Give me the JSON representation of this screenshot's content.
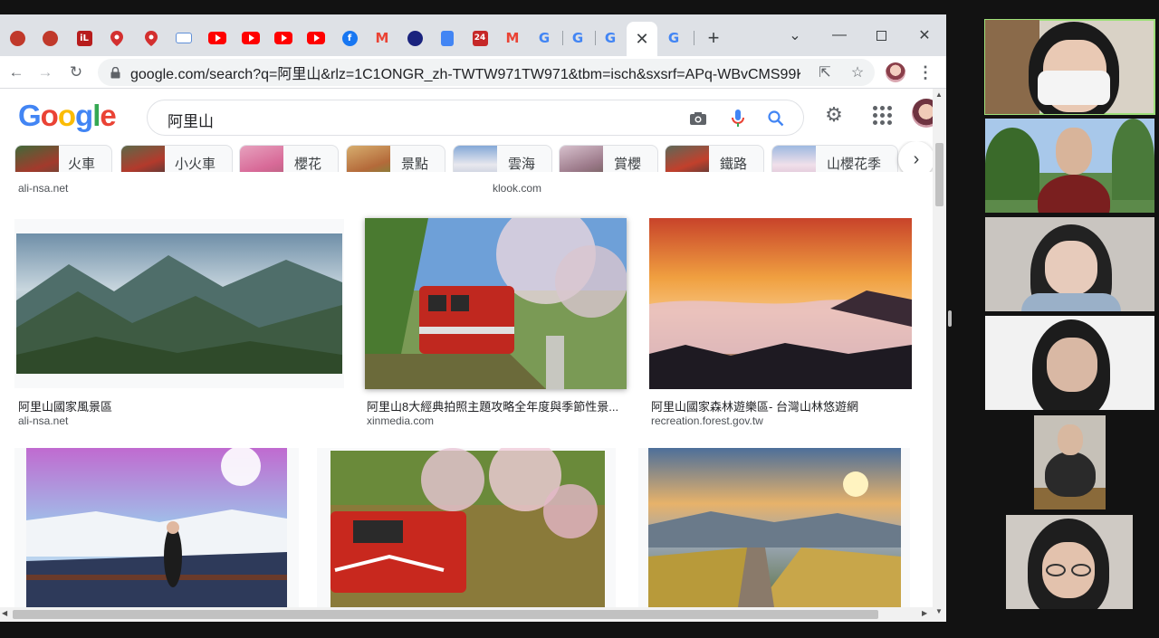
{
  "browser": {
    "tabs": [
      {
        "icon": "tab-favicon-red-swirl"
      },
      {
        "icon": "tab-favicon-red-swirl"
      },
      {
        "icon": "tab-favicon-il",
        "text": "iL"
      },
      {
        "icon": "map-pin-icon"
      },
      {
        "icon": "map-pin-icon"
      },
      {
        "icon": "keyboard-icon"
      },
      {
        "icon": "youtube-icon"
      },
      {
        "icon": "youtube-icon"
      },
      {
        "icon": "youtube-icon"
      },
      {
        "icon": "youtube-icon"
      },
      {
        "icon": "facebook-icon",
        "text": "f"
      },
      {
        "icon": "gmail-icon",
        "text": "M"
      },
      {
        "icon": "globe-icon"
      },
      {
        "icon": "docs-icon"
      },
      {
        "icon": "tab-favicon-24",
        "text": "24"
      },
      {
        "icon": "gmail-icon",
        "text": "M"
      },
      {
        "icon": "google-icon",
        "text": "G"
      },
      {
        "icon": "google-icon",
        "text": "G"
      },
      {
        "icon": "google-icon",
        "text": "G"
      },
      {
        "icon": "google-icon",
        "text": "G",
        "active": true
      },
      {
        "icon": "google-icon",
        "text": "G"
      }
    ],
    "new_tab_label": "+",
    "url": "google.com/search?q=阿里山&rlz=1C1ONGR_zh-TWTW971TW971&tbm=isch&sxsrf=APq-WBvCMS99K2..."
  },
  "google": {
    "logo": [
      "G",
      "o",
      "o",
      "g",
      "l",
      "e"
    ],
    "logo_colors": [
      "#4285f4",
      "#ea4335",
      "#fbbc05",
      "#4285f4",
      "#34a853",
      "#ea4335"
    ],
    "query": "阿里山",
    "chips": [
      {
        "label": "火車"
      },
      {
        "label": "小火車"
      },
      {
        "label": "櫻花"
      },
      {
        "label": "景點"
      },
      {
        "label": "雲海"
      },
      {
        "label": "賞櫻"
      },
      {
        "label": "鐵路"
      },
      {
        "label": "山櫻花季"
      }
    ],
    "top_sources": [
      "ali-nsa.net",
      "klook.com"
    ],
    "results": [
      {
        "title": "阿里山國家風景區",
        "source": "ali-nsa.net"
      },
      {
        "title": "阿里山8大經典拍照主題攻略全年度與季節性景...",
        "source": "xinmedia.com"
      },
      {
        "title": "阿里山國家森林遊樂區- 台灣山林悠遊網",
        "source": "recreation.forest.gov.tw"
      }
    ]
  },
  "colors": {
    "accent_blue": "#1a73e8",
    "active_speaker": "#9fe07a",
    "tab_strip": "#dee1e6"
  }
}
